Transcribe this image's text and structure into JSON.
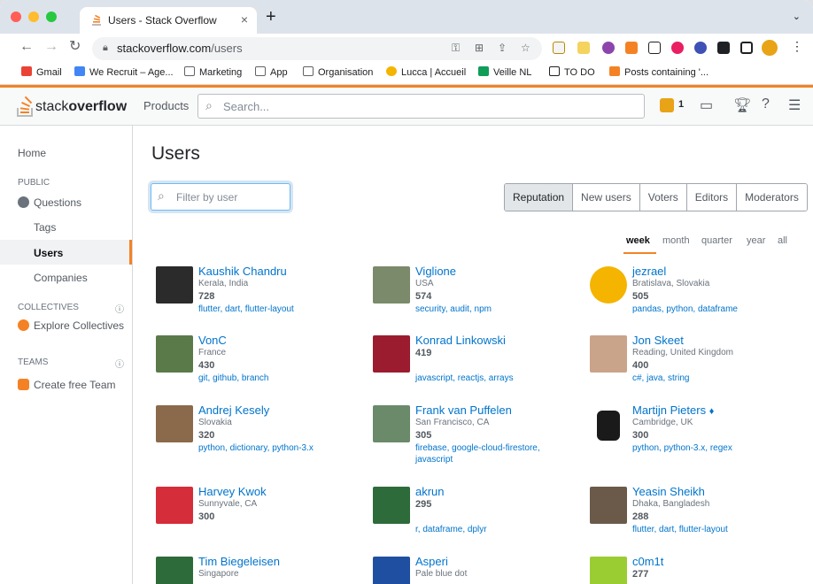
{
  "browser": {
    "tab_title": "Users - Stack Overflow",
    "tab_close": "×",
    "new_tab": "+",
    "url_host": "stackoverflow.com",
    "url_path": "/users",
    "bookmarks": [
      {
        "label": "Gmail",
        "color": "#ea4335"
      },
      {
        "label": "We Recruit – Age...",
        "color": "#4285f4"
      },
      {
        "label": "Marketing",
        "color": "#5f6368"
      },
      {
        "label": "App",
        "color": "#5f6368"
      },
      {
        "label": "Organisation",
        "color": "#5f6368"
      },
      {
        "label": "Lucca | Accueil",
        "color": "#f4b400"
      },
      {
        "label": "Veille NL",
        "color": "#0f9d58"
      },
      {
        "label": "TO DO",
        "color": "#202124"
      },
      {
        "label": "Posts containing '...",
        "color": "#f48225"
      }
    ]
  },
  "so_header": {
    "logo_light": "stack",
    "logo_bold": "overflow",
    "products": "Products",
    "search_placeholder": "Search...",
    "reputation": "1"
  },
  "sidebar": {
    "home": "Home",
    "public_heading": "PUBLIC",
    "questions": "Questions",
    "tags": "Tags",
    "users": "Users",
    "companies": "Companies",
    "collectives_heading": "COLLECTIVES",
    "explore_collectives": "Explore Collectives",
    "teams_heading": "TEAMS",
    "create_team": "Create free Team"
  },
  "main": {
    "title": "Users",
    "filter_placeholder": "Filter by user",
    "tabs": [
      "Reputation",
      "New users",
      "Voters",
      "Editors",
      "Moderators"
    ],
    "active_tab": "Reputation",
    "periods": [
      "week",
      "month",
      "quarter",
      "year",
      "all"
    ],
    "active_period": "week",
    "users": [
      {
        "name": "Kaushik Chandru",
        "location": "Kerala, India",
        "rep": "728",
        "tags": "flutter, dart, flutter-layout",
        "avatar_color": "#2b2b2b"
      },
      {
        "name": "Viglione",
        "location": "USA",
        "rep": "574",
        "tags": "security, audit, npm",
        "avatar_color": "#7a8a6a"
      },
      {
        "name": "jezrael",
        "location": "Bratislava, Slovakia",
        "rep": "505",
        "tags": "pandas, python, dataframe",
        "avatar_color": "#f4b400"
      },
      {
        "name": "VonC",
        "location": "France",
        "rep": "430",
        "tags": "git, github, branch",
        "avatar_color": "#5b7a4a"
      },
      {
        "name": "Konrad Linkowski",
        "location": "",
        "rep": "419",
        "tags": "javascript, reactjs, arrays",
        "avatar_color": "#9b1c2e"
      },
      {
        "name": "Jon Skeet",
        "location": "Reading, United Kingdom",
        "rep": "400",
        "tags": "c#, java, string",
        "avatar_color": "#c9a38a"
      },
      {
        "name": "Andrej Kesely",
        "location": "Slovakia",
        "rep": "320",
        "tags": "python, dictionary, python-3.x",
        "avatar_color": "#8a6a4a"
      },
      {
        "name": "Frank van Puffelen",
        "location": "San Francisco, CA",
        "rep": "305",
        "tags": "firebase, google-cloud-firestore, javascript",
        "avatar_color": "#6a8a6a"
      },
      {
        "name": "Martijn Pieters",
        "location": "Cambridge, UK",
        "rep": "300",
        "tags": "python, python-3.x, regex",
        "avatar_color": "#1a1a1a",
        "moderator": "♦"
      },
      {
        "name": "Harvey Kwok",
        "location": "Sunnyvale, CA",
        "rep": "300",
        "tags": "",
        "avatar_color": "#d62d3a"
      },
      {
        "name": "akrun",
        "location": "",
        "rep": "295",
        "tags": "r, dataframe, dplyr",
        "avatar_color": "#2e6b3a"
      },
      {
        "name": "Yeasin Sheikh",
        "location": "Dhaka, Bangladesh",
        "rep": "288",
        "tags": "flutter, dart, flutter-layout",
        "avatar_color": "#6b5a4a"
      },
      {
        "name": "Tim Biegeleisen",
        "location": "Singapore",
        "rep": "",
        "tags": "",
        "avatar_color": "#2e6b3a"
      },
      {
        "name": "Asperi",
        "location": "Pale blue dot",
        "rep": "",
        "tags": "",
        "avatar_color": "#1f4fa0"
      },
      {
        "name": "c0m1t",
        "location": "",
        "rep": "277",
        "tags": "",
        "avatar_color": "#9acd32"
      }
    ]
  },
  "colors": {
    "so_orange": "#f48225",
    "link_blue": "#0074cc"
  }
}
